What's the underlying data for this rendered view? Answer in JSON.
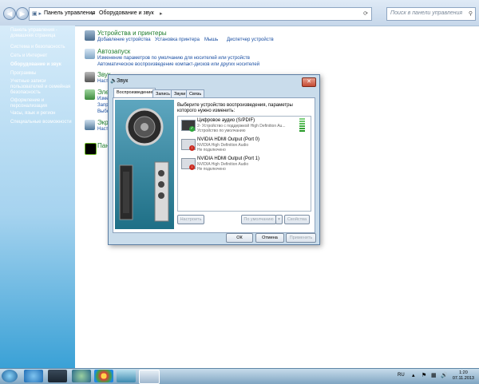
{
  "address": {
    "segments": [
      "Панель управления",
      "Оборудование и звук"
    ],
    "search_placeholder": "Поиск в панели управления"
  },
  "sidebar": {
    "items": [
      {
        "label": "Панель управления - домашняя страница"
      },
      {
        "label": "Система и безопасность"
      },
      {
        "label": "Сеть и Интернет"
      },
      {
        "label": "Оборудование и звук",
        "selected": true
      },
      {
        "label": "Программы"
      },
      {
        "label": "Учетные записи пользователей и семейная безопасность"
      },
      {
        "label": "Оформление и персонализация"
      },
      {
        "label": "Часы, язык и регион"
      },
      {
        "label": "Специальные возможности"
      }
    ]
  },
  "main": {
    "devices": {
      "title": "Устройства и принтеры",
      "links": [
        "Добавление устройства",
        "Установка принтера",
        "Мышь",
        "Диспетчер устройств"
      ]
    },
    "autoplay": {
      "title": "Автозапуск",
      "links": [
        "Изменение параметров по умолчанию для носителей или устройств",
        "Автоматическое воспроизведение компакт-дисков или других носителей"
      ]
    },
    "partials": [
      "Звук",
      "Элек",
      "Экр",
      "Пане"
    ],
    "partial_links": [
      "Наст",
      "Изме",
      "Запр",
      "Выбо",
      "Наст"
    ]
  },
  "dialog": {
    "title": "Звук",
    "tabs": [
      "Воспроизведение",
      "Запись",
      "Звуки",
      "Связь"
    ],
    "instruction": "Выберите устройство воспроизведения, параметры которого нужно изменить:",
    "devices": [
      {
        "name": "Цифровое аудио (S/PDIF)",
        "sub1": "2- Устройство с поддержкой High Definition Au...",
        "sub2": "Устройство по умолчанию",
        "status": "default"
      },
      {
        "name": "NVIDIA HDMI Output (Port 0)",
        "sub1": "NVIDIA High Definition Audio",
        "sub2": "Не подключено",
        "status": "unplugged"
      },
      {
        "name": "NVIDIA HDMI Output (Port 1)",
        "sub1": "NVIDIA High Definition Audio",
        "sub2": "Не подключено",
        "status": "unplugged"
      }
    ],
    "buttons": {
      "configure": "Настроить",
      "default": "По умолчанию",
      "properties": "Свойства",
      "ok": "ОК",
      "cancel": "Отмена",
      "apply": "Применить"
    }
  },
  "taskbar": {
    "lang": "RU",
    "time": "1:20",
    "date": "07.11.2013"
  },
  "colors": {
    "link": "#1a4fa3",
    "category": "#1e7d2d",
    "ok_badge": "#2ea63b",
    "unplugged_badge": "#cc2b20"
  }
}
